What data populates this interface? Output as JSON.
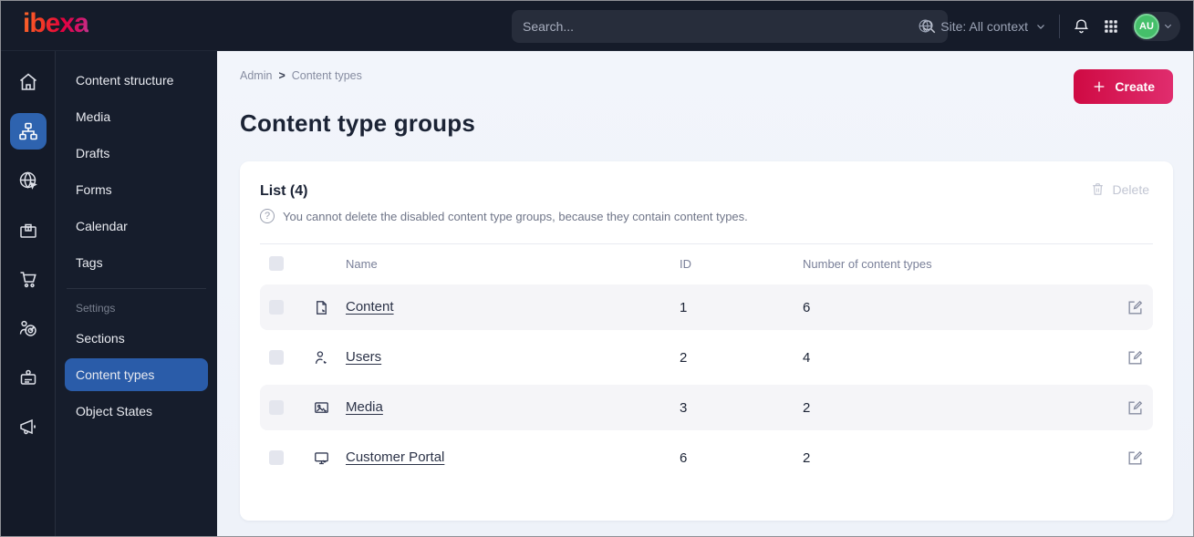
{
  "topbar": {
    "logo": "ibexa",
    "search_placeholder": "Search...",
    "site_context": "Site: All context",
    "avatar_initials": "AU"
  },
  "sidebar": {
    "menu_items": [
      {
        "label": "Content structure"
      },
      {
        "label": "Media"
      },
      {
        "label": "Drafts"
      },
      {
        "label": "Forms"
      },
      {
        "label": "Calendar"
      },
      {
        "label": "Tags"
      }
    ],
    "settings_section_label": "Settings",
    "settings_items": [
      {
        "label": "Sections"
      },
      {
        "label": "Content types",
        "active": true
      },
      {
        "label": "Object States"
      }
    ]
  },
  "main": {
    "breadcrumb": {
      "parent": "Admin",
      "separator": ">",
      "current": "Content types"
    },
    "create_label": "Create",
    "page_title": "Content type groups",
    "card": {
      "list_title": "List (4)",
      "help_glyph": "?",
      "info_text": "You cannot delete the disabled content type groups, because they contain content types.",
      "delete_label": "Delete",
      "table": {
        "columns": {
          "name": "Name",
          "id": "ID",
          "count": "Number of content types"
        },
        "rows": [
          {
            "name": "Content",
            "icon": "file-icon",
            "id": "1",
            "count": "6"
          },
          {
            "name": "Users",
            "icon": "user-icon",
            "id": "2",
            "count": "4"
          },
          {
            "name": "Media",
            "icon": "image-icon",
            "id": "3",
            "count": "2"
          },
          {
            "name": "Customer Portal",
            "icon": "monitor-icon",
            "id": "6",
            "count": "2"
          }
        ]
      }
    }
  },
  "colors": {
    "topbar_bg": "#151b29",
    "accent_blue": "#2a5ca9",
    "brand_pink": "#e02d6e",
    "brand_red": "#cf0a43",
    "avatar_green": "#45bf6a",
    "row_stripe": "#f5f5f8"
  }
}
